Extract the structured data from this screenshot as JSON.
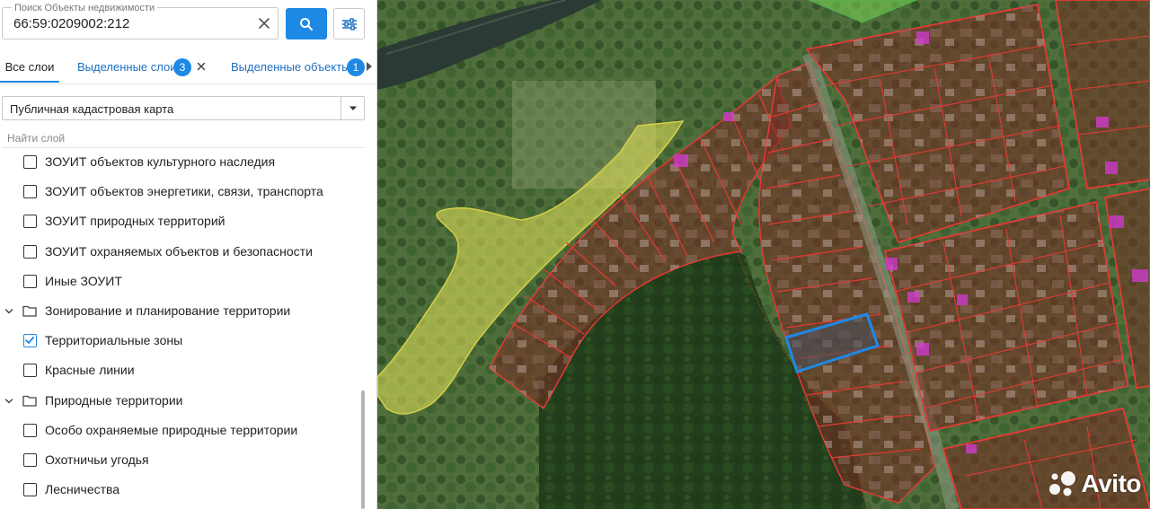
{
  "search": {
    "label": "Поиск Объекты недвижимости",
    "value": "66:59:0209002:212"
  },
  "tabs": {
    "all_layers": "Все слои",
    "selected_layers": "Выделенные слои",
    "selected_layers_count": "3",
    "selected_objects": "Выделенные объекты",
    "selected_objects_count": "1"
  },
  "basemap": {
    "selected": "Публичная кадастровая карта"
  },
  "layer_search": {
    "placeholder": "Найти слой"
  },
  "layers": [
    {
      "type": "item",
      "label": "ЗОУИТ объектов культурного наследия",
      "checked": false
    },
    {
      "type": "item",
      "label": "ЗОУИТ объектов энергетики, связи, транспорта",
      "checked": false
    },
    {
      "type": "item",
      "label": "ЗОУИТ природных территорий",
      "checked": false
    },
    {
      "type": "item",
      "label": "ЗОУИТ охраняемых объектов и безопасности",
      "checked": false
    },
    {
      "type": "item",
      "label": "Иные ЗОУИТ",
      "checked": false
    },
    {
      "type": "group",
      "label": "Зонирование и планирование территории",
      "expanded": true
    },
    {
      "type": "item",
      "label": "Территориальные зоны",
      "checked": true
    },
    {
      "type": "item",
      "label": "Красные линии",
      "checked": false
    },
    {
      "type": "group",
      "label": "Природные территории",
      "expanded": true
    },
    {
      "type": "item",
      "label": "Особо охраняемые природные территории",
      "checked": false
    },
    {
      "type": "item",
      "label": "Охотничьи угодья",
      "checked": false
    },
    {
      "type": "item",
      "label": "Лесничества",
      "checked": false
    }
  ],
  "watermark": "Avito",
  "colors": {
    "accent": "#1e88e5",
    "parcel_outline": "#e53935",
    "selected_parcel": "#1e88e5",
    "zone_yellow": "#e8e55a",
    "zone_green": "#7ed957"
  },
  "icons": {
    "search": "search-icon",
    "clear": "close-icon",
    "filter": "sliders-icon",
    "folder": "folder-icon",
    "chevron": "chevron-down-icon",
    "check": "check-icon"
  }
}
